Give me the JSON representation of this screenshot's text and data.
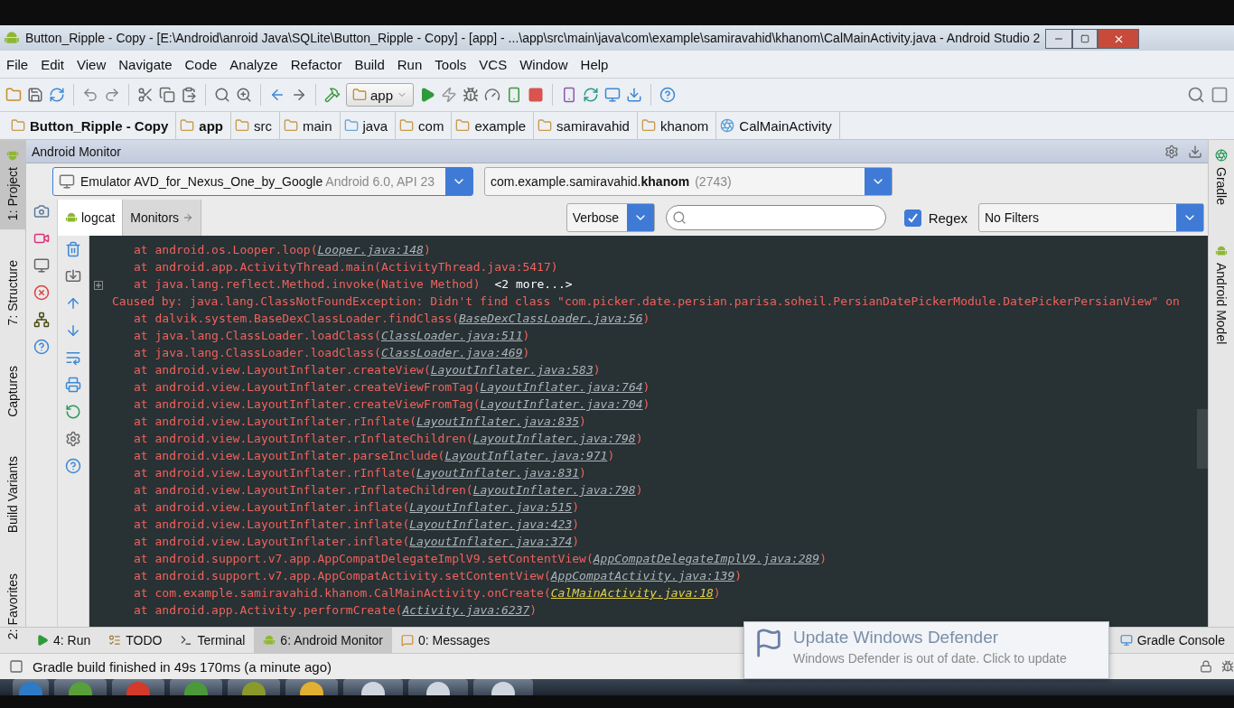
{
  "window": {
    "title": "Button_Ripple - Copy - [E:\\Android\\anroid Java\\SQLite\\Button_Ripple - Copy] - [app] - ...\\app\\src\\main\\java\\com\\example\\samiravahid\\khanom\\CalMainActivity.java - Android Studio 2"
  },
  "menu": [
    "File",
    "Edit",
    "View",
    "Navigate",
    "Code",
    "Analyze",
    "Refactor",
    "Build",
    "Run",
    "Tools",
    "VCS",
    "Window",
    "Help"
  ],
  "toolbar": {
    "run_config": "app"
  },
  "breadcrumbs": [
    {
      "label": "Button_Ripple - Copy",
      "kind": "module"
    },
    {
      "label": "app",
      "kind": "module"
    },
    {
      "label": "src",
      "kind": "folder"
    },
    {
      "label": "main",
      "kind": "folder"
    },
    {
      "label": "java",
      "kind": "source"
    },
    {
      "label": "com",
      "kind": "package"
    },
    {
      "label": "example",
      "kind": "package"
    },
    {
      "label": "samiravahid",
      "kind": "package"
    },
    {
      "label": "khanom",
      "kind": "package"
    },
    {
      "label": "CalMainActivity",
      "kind": "class"
    }
  ],
  "left_tool_tabs": [
    {
      "label": "1: Project",
      "selected": true
    },
    {
      "label": "7: Structure",
      "selected": false
    },
    {
      "label": "Captures",
      "selected": false
    },
    {
      "label": "Build Variants",
      "selected": false
    },
    {
      "label": "2: Favorites",
      "selected": false
    }
  ],
  "right_tool_tabs": [
    {
      "label": "Gradle"
    },
    {
      "label": "Android Model"
    }
  ],
  "monitor": {
    "title": "Android Monitor",
    "device": {
      "name": "Emulator AVD_for_Nexus_One_by_Google",
      "detail": "Android 6.0, API 23"
    },
    "process": {
      "name": "com.example.samiravahid.**khanom**",
      "pid": "(2743)"
    },
    "tabs": [
      {
        "label": "logcat",
        "selected": true
      },
      {
        "label": "Monitors",
        "selected": false
      }
    ],
    "level": "Verbose",
    "regex": {
      "label": "Regex",
      "checked": true
    },
    "filter": "No Filters",
    "log": [
      {
        "kind": "frame",
        "text": "at android.os.Looper.loop(",
        "link": "Looper.java:148",
        "end": ")"
      },
      {
        "kind": "frame",
        "text": "at android.app.ActivityThread.main(ActivityThread.java:5417)"
      },
      {
        "kind": "frame",
        "text": "at java.lang.reflect.Method.invoke(Native Method)",
        "more": "<2 more...>",
        "folded": true
      },
      {
        "kind": "cause",
        "text": "Caused by: java.lang.ClassNotFoundException: Didn't find class \"com.picker.date.persian.parisa.soheil.PersianDatePickerModule.DatePickerPersianView\" on"
      },
      {
        "kind": "frame",
        "text": "at dalvik.system.BaseDexClassLoader.findClass(",
        "link": "BaseDexClassLoader.java:56",
        "end": ")"
      },
      {
        "kind": "frame",
        "text": "at java.lang.ClassLoader.loadClass(",
        "link": "ClassLoader.java:511",
        "end": ")"
      },
      {
        "kind": "frame",
        "text": "at java.lang.ClassLoader.loadClass(",
        "link": "ClassLoader.java:469",
        "end": ")"
      },
      {
        "kind": "frame",
        "text": "at android.view.LayoutInflater.createView(",
        "link": "LayoutInflater.java:583",
        "end": ")"
      },
      {
        "kind": "frame",
        "text": "at android.view.LayoutInflater.createViewFromTag(",
        "link": "LayoutInflater.java:764",
        "end": ")"
      },
      {
        "kind": "frame",
        "text": "at android.view.LayoutInflater.createViewFromTag(",
        "link": "LayoutInflater.java:704",
        "end": ")"
      },
      {
        "kind": "frame",
        "text": "at android.view.LayoutInflater.rInflate(",
        "link": "LayoutInflater.java:835",
        "end": ")"
      },
      {
        "kind": "frame",
        "text": "at android.view.LayoutInflater.rInflateChildren(",
        "link": "LayoutInflater.java:798",
        "end": ")"
      },
      {
        "kind": "frame",
        "text": "at android.view.LayoutInflater.parseInclude(",
        "link": "LayoutInflater.java:971",
        "end": ")"
      },
      {
        "kind": "frame",
        "text": "at android.view.LayoutInflater.rInflate(",
        "link": "LayoutInflater.java:831",
        "end": ")"
      },
      {
        "kind": "frame",
        "text": "at android.view.LayoutInflater.rInflateChildren(",
        "link": "LayoutInflater.java:798",
        "end": ")"
      },
      {
        "kind": "frame",
        "text": "at android.view.LayoutInflater.inflate(",
        "link": "LayoutInflater.java:515",
        "end": ")"
      },
      {
        "kind": "frame",
        "text": "at android.view.LayoutInflater.inflate(",
        "link": "LayoutInflater.java:423",
        "end": ")"
      },
      {
        "kind": "frame",
        "text": "at android.view.LayoutInflater.inflate(",
        "link": "LayoutInflater.java:374",
        "end": ")"
      },
      {
        "kind": "frame",
        "text": "at android.support.v7.app.AppCompatDelegateImplV9.setContentView(",
        "link": "AppCompatDelegateImplV9.java:289",
        "end": ")"
      },
      {
        "kind": "frame",
        "text": "at android.support.v7.app.AppCompatActivity.setContentView(",
        "link": "AppCompatActivity.java:139",
        "end": ")"
      },
      {
        "kind": "frame",
        "text": "at com.example.samiravahid.khanom.CalMainActivity.onCreate(",
        "link": "CalMainActivity.java:18",
        "end": ")",
        "project": true
      },
      {
        "kind": "frame",
        "text": "at android.app.Activity.performCreate(",
        "link": "Activity.java:6237",
        "end": ")"
      }
    ]
  },
  "bottom_tool_tabs": [
    {
      "label": "4: Run",
      "selected": false
    },
    {
      "label": "TODO",
      "selected": false
    },
    {
      "label": "Terminal",
      "selected": false
    },
    {
      "label": "6: Android Monitor",
      "selected": true
    },
    {
      "label": "0: Messages",
      "selected": false
    }
  ],
  "bottom_right_tabs": [
    {
      "label": "Gradle Console"
    }
  ],
  "status_bar": {
    "message": "Gradle build finished in 49s 170ms (a minute ago)"
  },
  "notification": {
    "title": "Update Windows Defender",
    "body": "Windows Defender is out of date. Click to update"
  }
}
